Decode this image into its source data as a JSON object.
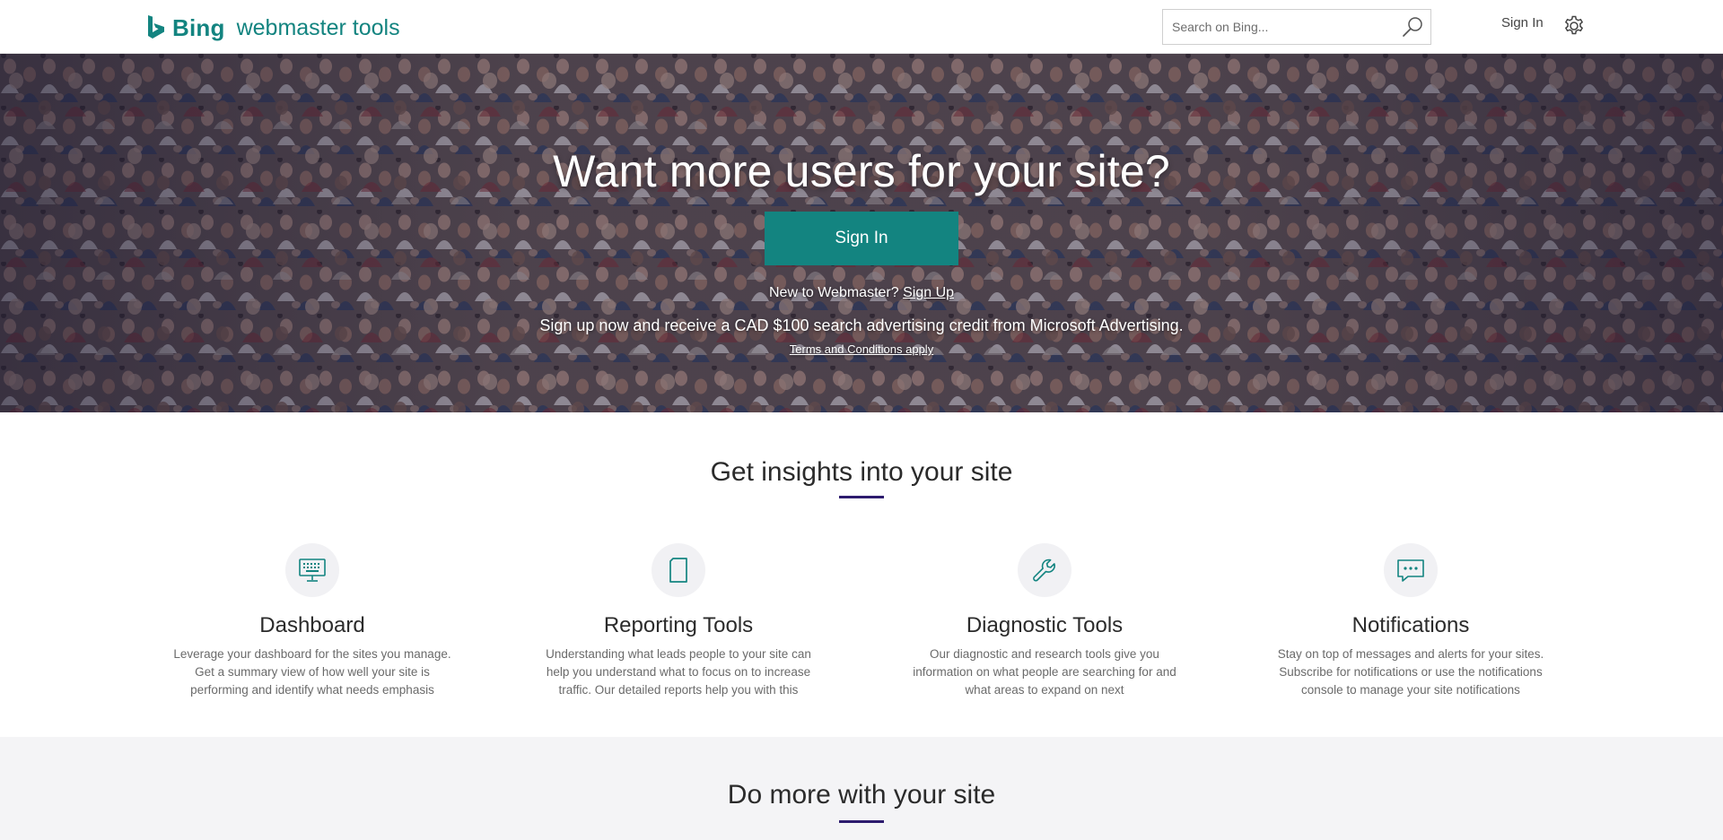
{
  "header": {
    "brand_name": "Bing",
    "brand_product": "webmaster tools",
    "search_placeholder": "Search on Bing...",
    "signin_label": "Sign In",
    "icons": {
      "logo": "bing-logo-icon",
      "search": "search-icon",
      "settings": "gear-icon"
    }
  },
  "hero": {
    "title": "Want more users for your site?",
    "signin_button": "Sign In",
    "new_prefix": "New to Webmaster?",
    "signup_link": "Sign Up",
    "offer": "Sign up now and receive a CAD $100 search advertising credit from Microsoft Advertising.",
    "terms_link": "Terms and Conditions apply"
  },
  "insights": {
    "title": "Get insights into your site",
    "features": [
      {
        "icon": "monitor-keyboard-icon",
        "title": "Dashboard",
        "description": "Leverage your dashboard for the sites you manage. Get a summary view of how well your site is performing and identify what needs emphasis"
      },
      {
        "icon": "document-icon",
        "title": "Reporting Tools",
        "description": "Understanding what leads people to your site can help you understand what to focus on to increase traffic. Our detailed reports help you with this"
      },
      {
        "icon": "wrench-icon",
        "title": "Diagnostic Tools",
        "description": "Our diagnostic and research tools give you information on what people are searching for and what areas to expand on next"
      },
      {
        "icon": "chat-bubble-icon",
        "title": "Notifications",
        "description": "Stay on top of messages and alerts for your sites. Subscribe for notifications or use the notifications console to manage your site notifications"
      }
    ]
  },
  "domore": {
    "title": "Do more with your site"
  },
  "colors": {
    "accent": "#138480",
    "underline": "#2d1b6e",
    "hero_overlay": "#2a2340",
    "muted_text": "#6a6a6a"
  }
}
